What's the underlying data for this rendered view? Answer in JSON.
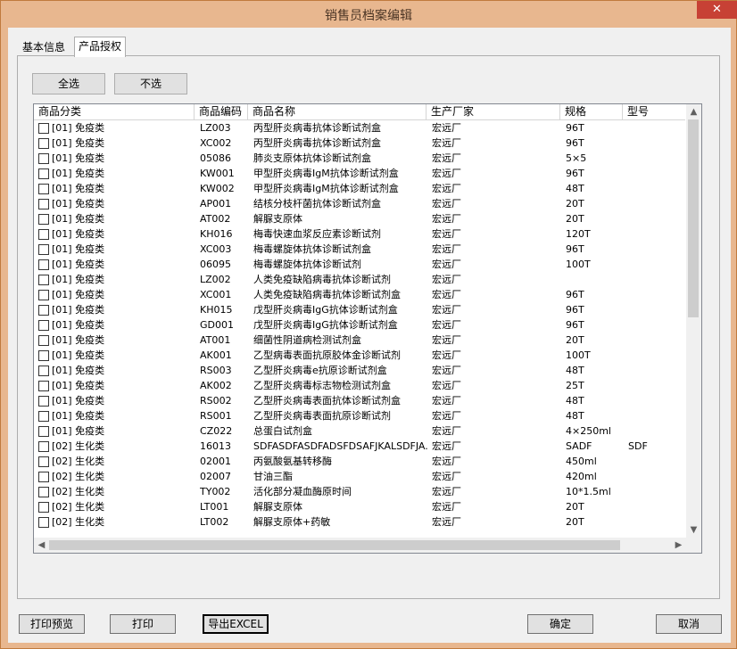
{
  "window": {
    "title": "销售员档案编辑",
    "close_glyph": "✕"
  },
  "tabs": [
    "基本信息",
    "产品授权"
  ],
  "buttons": {
    "select_all": "全选",
    "select_none": "不选"
  },
  "columns": [
    "商品分类",
    "商品编码",
    "商品名称",
    "生产厂家",
    "规格",
    "型号"
  ],
  "rows": [
    {
      "category": "[01] 免疫类",
      "code": "LZ003",
      "name": "丙型肝炎病毒抗体诊断试剂盒",
      "maker": "宏远厂",
      "spec": "96T",
      "model": ""
    },
    {
      "category": "[01] 免疫类",
      "code": "XC002",
      "name": "丙型肝炎病毒抗体诊断试剂盒",
      "maker": "宏远厂",
      "spec": "96T",
      "model": ""
    },
    {
      "category": "[01] 免疫类",
      "code": "05086",
      "name": "肺炎支原体抗体诊断试剂盒",
      "maker": "宏远厂",
      "spec": "5×5",
      "model": ""
    },
    {
      "category": "[01] 免疫类",
      "code": "KW001",
      "name": "甲型肝炎病毒IgM抗体诊断试剂盒",
      "maker": "宏远厂",
      "spec": "96T",
      "model": ""
    },
    {
      "category": "[01] 免疫类",
      "code": "KW002",
      "name": "甲型肝炎病毒IgM抗体诊断试剂盒",
      "maker": "宏远厂",
      "spec": "48T",
      "model": ""
    },
    {
      "category": "[01] 免疫类",
      "code": "AP001",
      "name": "结核分枝杆菌抗体诊断试剂盒",
      "maker": "宏远厂",
      "spec": "20T",
      "model": ""
    },
    {
      "category": "[01] 免疫类",
      "code": "AT002",
      "name": "解脲支原体",
      "maker": "宏远厂",
      "spec": "20T",
      "model": ""
    },
    {
      "category": "[01] 免疫类",
      "code": "KH016",
      "name": "梅毒快速血浆反应素诊断试剂",
      "maker": "宏远厂",
      "spec": "120T",
      "model": ""
    },
    {
      "category": "[01] 免疫类",
      "code": "XC003",
      "name": "梅毒螺旋体抗体诊断试剂盒",
      "maker": "宏远厂",
      "spec": "96T",
      "model": ""
    },
    {
      "category": "[01] 免疫类",
      "code": "06095",
      "name": "梅毒螺旋体抗体诊断试剂",
      "maker": "宏远厂",
      "spec": "100T",
      "model": ""
    },
    {
      "category": "[01] 免疫类",
      "code": "LZ002",
      "name": "人类免疫缺陷病毒抗体诊断试剂",
      "maker": "宏远厂",
      "spec": "",
      "model": ""
    },
    {
      "category": "[01] 免疫类",
      "code": "XC001",
      "name": "人类免疫缺陷病毒抗体诊断试剂盒",
      "maker": "宏远厂",
      "spec": "96T",
      "model": ""
    },
    {
      "category": "[01] 免疫类",
      "code": "KH015",
      "name": "戊型肝炎病毒IgG抗体诊断试剂盒",
      "maker": "宏远厂",
      "spec": "96T",
      "model": ""
    },
    {
      "category": "[01] 免疫类",
      "code": "GD001",
      "name": "戊型肝炎病毒IgG抗体诊断试剂盒",
      "maker": "宏远厂",
      "spec": "96T",
      "model": ""
    },
    {
      "category": "[01] 免疫类",
      "code": "AT001",
      "name": "细菌性阴道病检测试剂盒",
      "maker": "宏远厂",
      "spec": "20T",
      "model": ""
    },
    {
      "category": "[01] 免疫类",
      "code": "AK001",
      "name": "乙型病毒表面抗原胶体金诊断试剂",
      "maker": "宏远厂",
      "spec": "100T",
      "model": ""
    },
    {
      "category": "[01] 免疫类",
      "code": "RS003",
      "name": "乙型肝炎病毒e抗原诊断试剂盒",
      "maker": "宏远厂",
      "spec": "48T",
      "model": ""
    },
    {
      "category": "[01] 免疫类",
      "code": "AK002",
      "name": "乙型肝炎病毒标志物检测试剂盒",
      "maker": "宏远厂",
      "spec": "25T",
      "model": ""
    },
    {
      "category": "[01] 免疫类",
      "code": "RS002",
      "name": "乙型肝炎病毒表面抗体诊断试剂盒",
      "maker": "宏远厂",
      "spec": "48T",
      "model": ""
    },
    {
      "category": "[01] 免疫类",
      "code": "RS001",
      "name": "乙型肝炎病毒表面抗原诊断试剂",
      "maker": "宏远厂",
      "spec": "48T",
      "model": ""
    },
    {
      "category": "[01] 免疫类",
      "code": "CZ022",
      "name": "总蛋白试剂盒",
      "maker": "宏远厂",
      "spec": "4×250ml",
      "model": ""
    },
    {
      "category": "[02] 生化类",
      "code": "16013",
      "name": "SDFASDFASDFADSFDSAFJKALSDFJA...",
      "maker": "宏远厂",
      "spec": "SADF",
      "model": "SDF"
    },
    {
      "category": "[02] 生化类",
      "code": "02001",
      "name": "丙氨酸氨基转移酶",
      "maker": "宏远厂",
      "spec": "450ml",
      "model": ""
    },
    {
      "category": "[02] 生化类",
      "code": "02007",
      "name": "甘油三酯",
      "maker": "宏远厂",
      "spec": "420ml",
      "model": ""
    },
    {
      "category": "[02] 生化类",
      "code": "TY002",
      "name": "活化部分凝血酶原时间",
      "maker": "宏远厂",
      "spec": "10*1.5ml",
      "model": ""
    },
    {
      "category": "[02] 生化类",
      "code": "LT001",
      "name": "解脲支原体",
      "maker": "宏远厂",
      "spec": "20T",
      "model": ""
    },
    {
      "category": "[02] 生化类",
      "code": "LT002",
      "name": "解脲支原体+药敏",
      "maker": "宏远厂",
      "spec": "20T",
      "model": ""
    }
  ],
  "scroll_arrows": {
    "up": "▲",
    "down": "▼",
    "left": "◀",
    "right": "▶"
  },
  "bottom_buttons": {
    "preview": "打印预览",
    "print": "打印",
    "export": "导出EXCEL",
    "ok": "确定",
    "cancel": "取消"
  },
  "icons": [
    "close-icon",
    "checkbox-icon",
    "scroll-up-arrow-icon",
    "scroll-down-arrow-icon",
    "scroll-left-arrow-icon",
    "scroll-right-arrow-icon"
  ],
  "colors": {
    "titlebar": "#e8b78f",
    "close": "#c74135",
    "client": "#f0f0f0",
    "list_bg": "#ffffff"
  }
}
